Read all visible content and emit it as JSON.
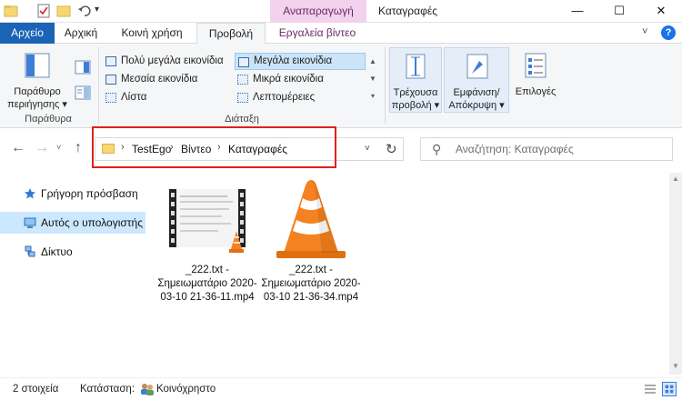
{
  "titlebar": {
    "contextual_tab": "Αναπαραγωγή",
    "window_title": "Καταγραφές",
    "minimize": "—",
    "maximize": "☐",
    "close": "✕",
    "qa_dropdown": "▾"
  },
  "ribbon_tabs": [
    {
      "label": "Αρχείο"
    },
    {
      "label": "Αρχική"
    },
    {
      "label": "Κοινή χρήση"
    },
    {
      "label": "Προβολή"
    },
    {
      "label": "Εργαλεία βίντεο"
    }
  ],
  "ribbon_collapse": "˅",
  "help": "?",
  "ribbon": {
    "panes": {
      "nav_pane_label": "Παράθυρο περιήγησης ▾",
      "group_label": "Παράθυρα"
    },
    "layout": {
      "items": [
        {
          "label": "Πολύ μεγάλα εικονίδια"
        },
        {
          "label": "Μεγάλα εικονίδια"
        },
        {
          "label": "Μεσαία εικονίδια"
        },
        {
          "label": "Μικρά εικονίδια"
        },
        {
          "label": "Λίστα"
        },
        {
          "label": "Λεπτομέρειες"
        }
      ],
      "selected": "Μεγάλα εικονίδια",
      "group_label": "Διάταξη",
      "scroll_glyphs": [
        "▲",
        "▼",
        "▾"
      ]
    },
    "current_view_label": "Τρέχουσα προβολή ▾",
    "show_hide_label": "Εμφάνιση/ Απόκρυψη ▾",
    "options_label": "Επιλογές"
  },
  "address": {
    "back": "←",
    "forward": "→",
    "recent": "˅",
    "up": "↑",
    "breadcrumbs": [
      "TestEgo",
      "Βίντεο",
      "Καταγραφές"
    ],
    "separator": "›",
    "dropdown": "˅",
    "refresh": "↻"
  },
  "search": {
    "icon": "⚲",
    "placeholder": "Αναζήτηση: Καταγραφές"
  },
  "nav_pane": [
    {
      "label": "Γρήγορη πρόσβαση",
      "icon": "star-icon"
    },
    {
      "label": "Αυτός ο υπολογιστής",
      "icon": "computer-icon"
    },
    {
      "label": "Δίκτυο",
      "icon": "network-icon"
    }
  ],
  "files": [
    {
      "name": "_222.txt - Σημειωματάριο 2020-03-10 21-36-11.mp4",
      "thumbnail": "video-thumbnail-icon"
    },
    {
      "name": "_222.txt - Σημειωματάριο 2020-03-10 21-36-34.mp4",
      "thumbnail": "vlc-cone-icon"
    }
  ],
  "status": {
    "count": "2 στοιχεία",
    "state_label": "Κατάσταση:",
    "state_value": "Κοινόχρηστο"
  },
  "colors": {
    "file_tab": "#1a63b5",
    "contextual_tab": "#f2d2ec",
    "highlight": "#e0201b",
    "selected_nav": "#cce8ff",
    "vlc_orange": "#f58220"
  }
}
